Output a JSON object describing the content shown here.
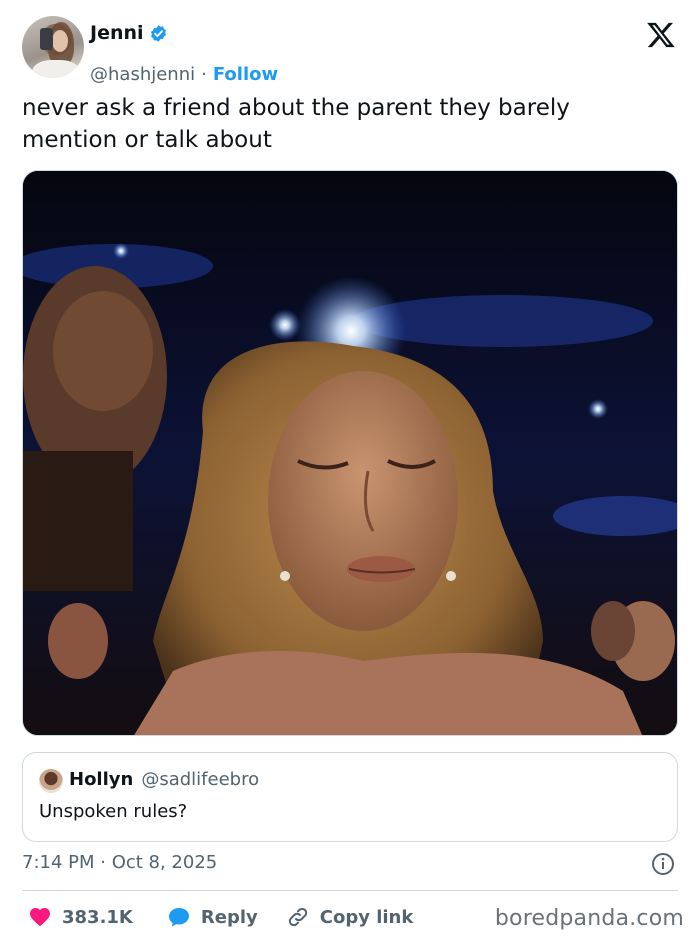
{
  "author": {
    "name": "Jenni",
    "handle": "@hashjenni",
    "separator": "·",
    "follow_label": "Follow",
    "verified": true
  },
  "icons": {
    "brand": "x-logo-icon",
    "verified": "verified-badge-icon",
    "info": "info-icon",
    "like": "heart-icon",
    "reply": "speech-bubble-icon",
    "copy": "link-icon"
  },
  "tweet": {
    "text": "never ask a friend about the parent they barely mention or talk about"
  },
  "quoted": {
    "name": "Hollyn",
    "handle": "@sadlifeebro",
    "text": "Unspoken rules?"
  },
  "meta": {
    "timestamp": "7:14 PM · Oct 8, 2025"
  },
  "actions": {
    "likes": "383.1K",
    "reply_label": "Reply",
    "copy_label": "Copy link"
  },
  "watermark": "boredpanda.com",
  "colors": {
    "accent": "#1d9bf0",
    "like": "#f91880",
    "text": "#0f1419",
    "muted": "#536471"
  }
}
